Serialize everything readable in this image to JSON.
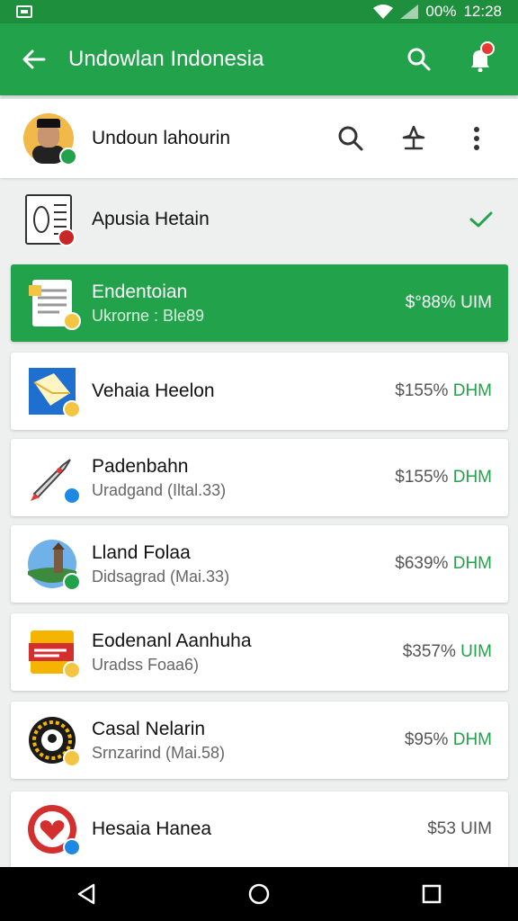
{
  "status_bar": {
    "battery": "00%",
    "time": "12:28"
  },
  "app_bar": {
    "title": "Undowlan Indonesia"
  },
  "profile": {
    "name": "Undoun lahourin"
  },
  "header_row": {
    "title": "Apusia Hetain"
  },
  "items": [
    {
      "name": "Endentoian",
      "subtitle": "Ukrorne : Ble89",
      "price": "$°88%",
      "unit": "UIM",
      "selected": true
    },
    {
      "name": "Vehaia Heelon",
      "subtitle": "",
      "price": "$155%",
      "unit": "DHM",
      "selected": false
    },
    {
      "name": "Padenbahn",
      "subtitle": "Uradgand (Iltal.33)",
      "price": "$155%",
      "unit": "DHM",
      "selected": false
    },
    {
      "name": "Lland Folaa",
      "subtitle": "Didsagrad (Mai.33)",
      "price": "$639%",
      "unit": "DHM",
      "selected": false
    },
    {
      "name": "Eodenanl Aanhuha",
      "subtitle": "Uradss Foaa6)",
      "price": "$357%",
      "unit": "UIM",
      "selected": false
    },
    {
      "name": "Casal Nelarin",
      "subtitle": "Srnzarind (Mai.58)",
      "price": "$95%",
      "unit": "DHM",
      "selected": false
    },
    {
      "name": "Hesaia Hanea",
      "subtitle": "",
      "price": "$53",
      "unit": "UIM",
      "selected": false
    }
  ],
  "colors": {
    "primary": "#22a24a",
    "status_bar": "#1e8f3c",
    "selected_row": "#22a24a",
    "badge": "#e53935"
  }
}
